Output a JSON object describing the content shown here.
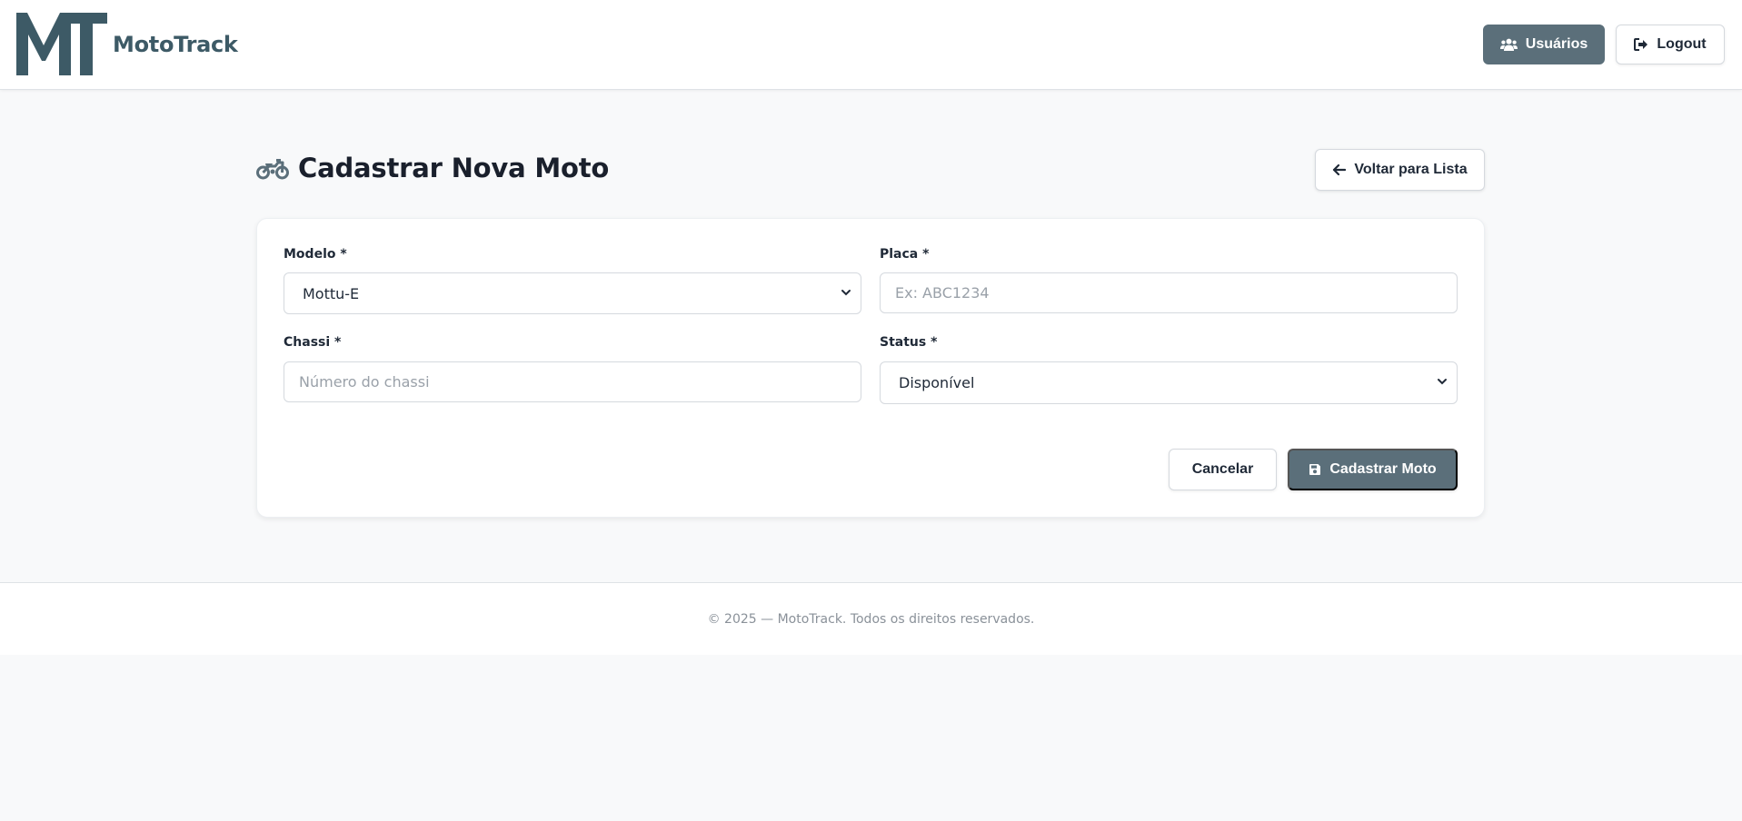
{
  "brand": {
    "logo_text": "MT",
    "name": "MotoTrack",
    "color": "#3d5a66"
  },
  "nav": {
    "users_label": "Usuários",
    "users_icon": "users-icon",
    "logout_label": "Logout",
    "logout_icon": "logout-icon"
  },
  "page": {
    "title": "Cadastrar Nova Moto",
    "title_icon": "motorcycle-icon",
    "back_label": "Voltar para Lista",
    "back_icon": "arrow-left-icon"
  },
  "form": {
    "modelo": {
      "label": "Modelo *",
      "value": "Mottu-E"
    },
    "placa": {
      "label": "Placa *",
      "placeholder": "Ex: ABC1234"
    },
    "chassi": {
      "label": "Chassi *",
      "placeholder": "Número do chassi"
    },
    "status": {
      "label": "Status *",
      "value": "Disponível"
    },
    "cancel_label": "Cancelar",
    "submit_label": "Cadastrar Moto",
    "submit_icon": "save-icon"
  },
  "footer": {
    "text": "© 2025 — MotoTrack. Todos os direitos reservados."
  },
  "colors": {
    "primary": "#5b6f7a",
    "background": "#f8f9fa",
    "card": "#ffffff"
  }
}
